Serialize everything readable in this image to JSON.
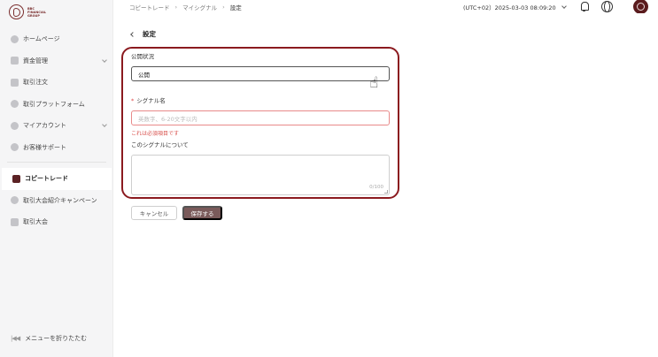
{
  "brand": {
    "logo_text": "BBC FINANCIAL GROUP",
    "accent": "#8b1a1f",
    "dark": "#5b1c1e"
  },
  "sidebar": {
    "items": [
      {
        "label": "ホームページ",
        "icon": "home-icon"
      },
      {
        "label": "資金管理",
        "icon": "wallet-icon",
        "expandable": true
      },
      {
        "label": "取引注文",
        "icon": "order-icon"
      },
      {
        "label": "取引プラットフォーム",
        "icon": "platform-icon"
      },
      {
        "label": "マイアカウント",
        "icon": "user-icon",
        "expandable": true
      },
      {
        "label": "お客様サポート",
        "icon": "help-icon"
      }
    ],
    "items2": [
      {
        "label": "コピートレード",
        "icon": "copy-trade-icon",
        "active": true
      },
      {
        "label": "取引大会紹介キャンペーン",
        "icon": "referral-icon"
      },
      {
        "label": "取引大会",
        "icon": "trophy-icon"
      }
    ],
    "collapse_label": "メニューを折りたたむ"
  },
  "topbar": {
    "breadcrumb": [
      "コピートレード",
      "マイシグナル",
      "設定"
    ],
    "timezone": "(UTC+02）2025-03-03 08:09:20"
  },
  "page": {
    "title": "設定"
  },
  "form": {
    "public_status_label": "公開状況",
    "public_status_value": "公開",
    "signal_name_label": "シグナル名",
    "signal_name_placeholder": "英数字、6-20文字以内",
    "signal_name_error": "これは必須項目です",
    "about_label": "このシグナルについて",
    "about_count": "0/100"
  },
  "actions": {
    "cancel_label": "キャンセル",
    "save_label": "保存する"
  }
}
